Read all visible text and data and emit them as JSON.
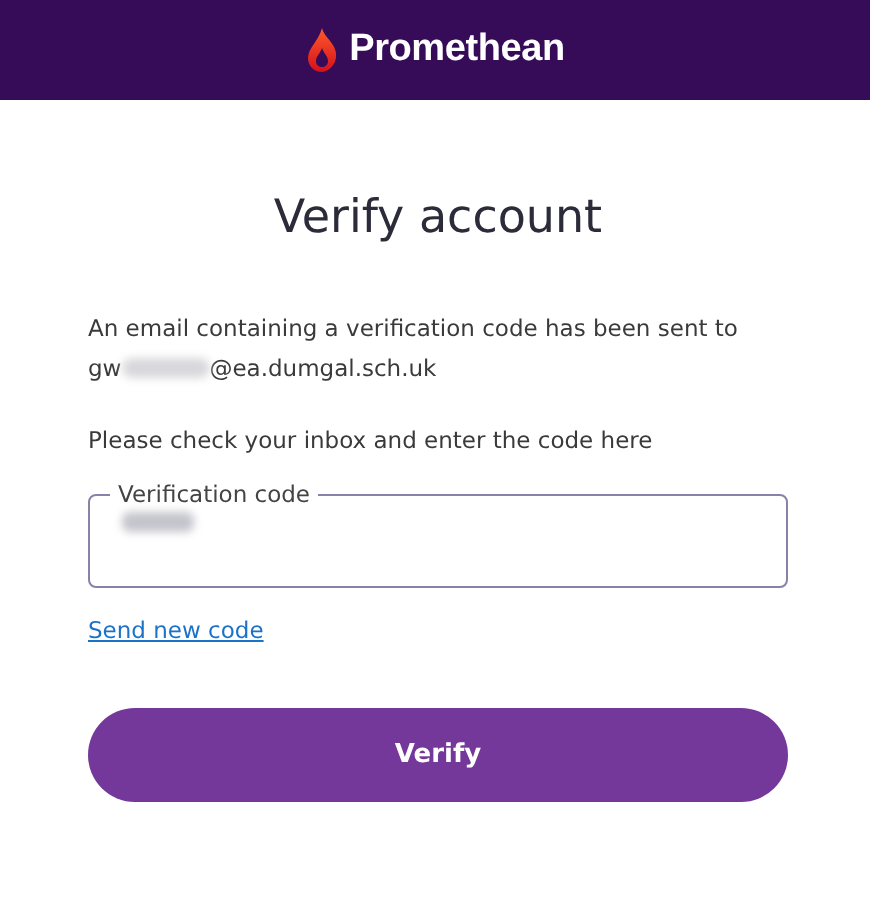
{
  "header": {
    "brand": "Promethean"
  },
  "title": "Verify account",
  "message": "An email containing a verification code has been sent to",
  "email": {
    "start": "gw",
    "end": "@ea.dumgal.sch.uk"
  },
  "instruction": "Please check your inbox and enter the code here",
  "code_field": {
    "label": "Verification code"
  },
  "resend_link": "Send new code",
  "submit_button": "Verify"
}
